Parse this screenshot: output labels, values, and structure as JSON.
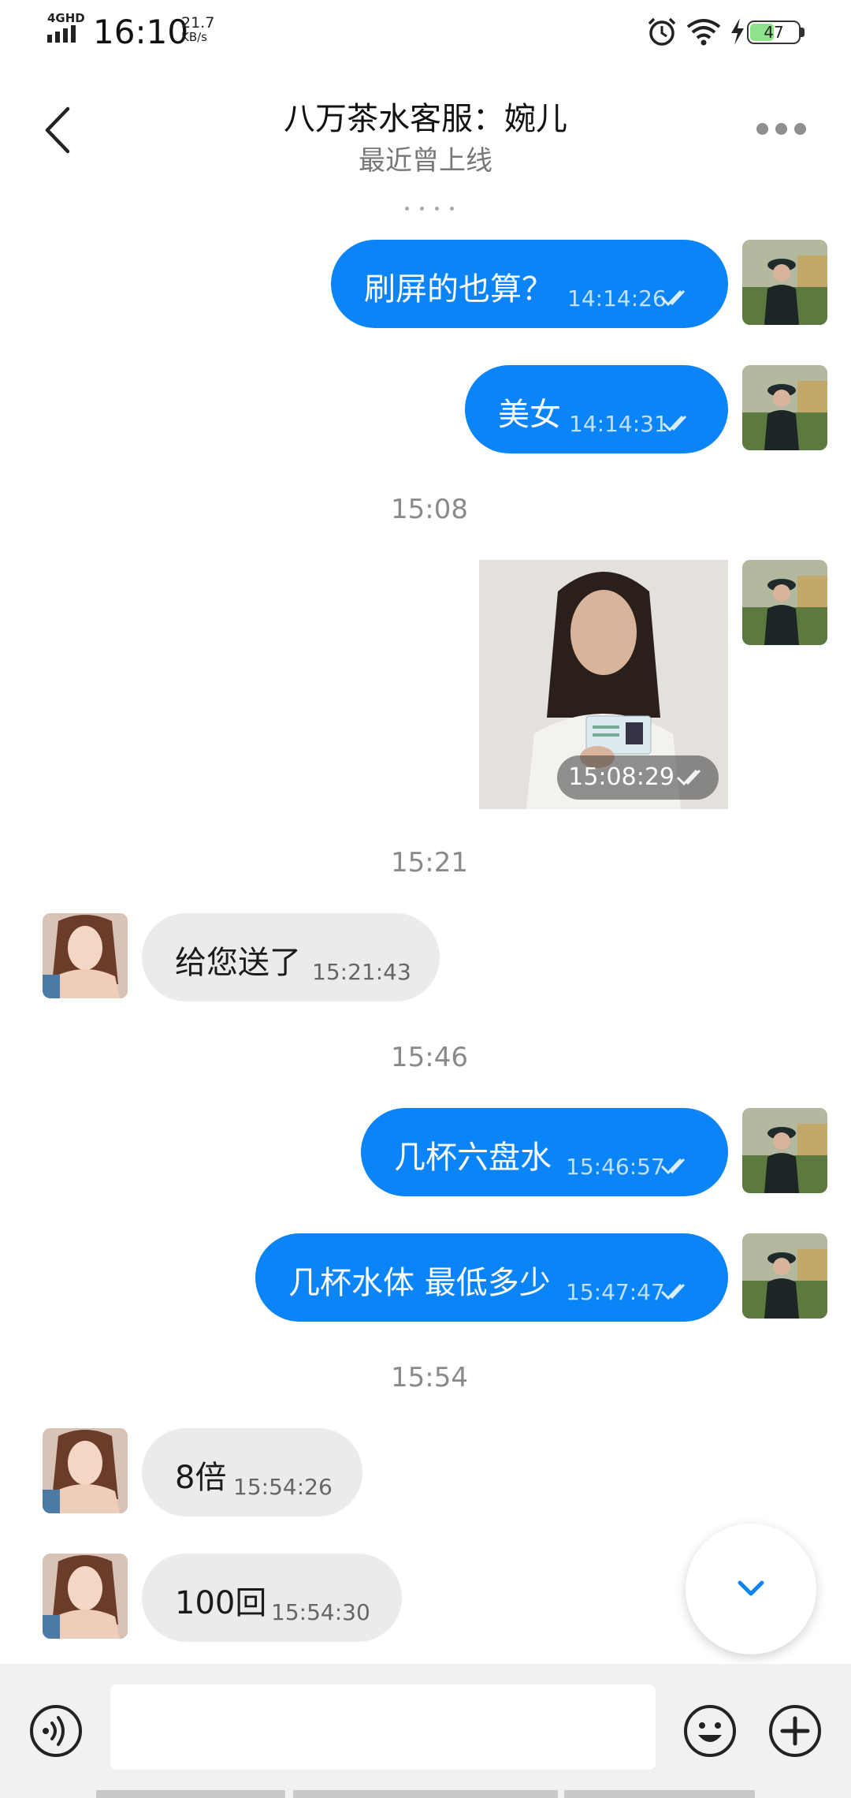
{
  "status_bar": {
    "network": "4GHD",
    "time": "16:10",
    "speed_value": "21.7",
    "speed_unit": "KB/s",
    "battery": "47",
    "icons": [
      "signal-icon",
      "alarm-icon",
      "wifi-icon",
      "charging-icon",
      "battery-icon"
    ]
  },
  "header": {
    "title": "八万茶水客服：婉儿",
    "subtitle": "最近曾上线"
  },
  "messages": [
    {
      "side": "out",
      "text": "刷屏的也算？",
      "time": "14:14:26"
    },
    {
      "side": "out",
      "text": "美女",
      "time": "14:14:31"
    },
    {
      "separator": "15:08"
    },
    {
      "side": "out",
      "type": "image",
      "image": "photo-of-woman-holding-id-card",
      "time": "15:08:29"
    },
    {
      "separator": "15:21"
    },
    {
      "side": "in",
      "text": "给您送了",
      "time": "15:21:43"
    },
    {
      "separator": "15:46"
    },
    {
      "side": "out",
      "text": "几杯六盘水",
      "time": "15:46:57"
    },
    {
      "side": "out",
      "text": "几杯水体 最低多少",
      "time": "15:47:47"
    },
    {
      "separator": "15:54"
    },
    {
      "side": "in",
      "text": "8倍",
      "time": "15:54:26"
    },
    {
      "side": "in",
      "text": "100回",
      "time": "15:54:30"
    }
  ],
  "input_bar": {
    "placeholder": "",
    "icons": [
      "voice-icon",
      "emoji-icon",
      "plus-icon"
    ]
  },
  "colors": {
    "outgoing_bubble": "#0a84f7",
    "incoming_bubble": "#ebebeb",
    "accent": "#0a84f7"
  }
}
